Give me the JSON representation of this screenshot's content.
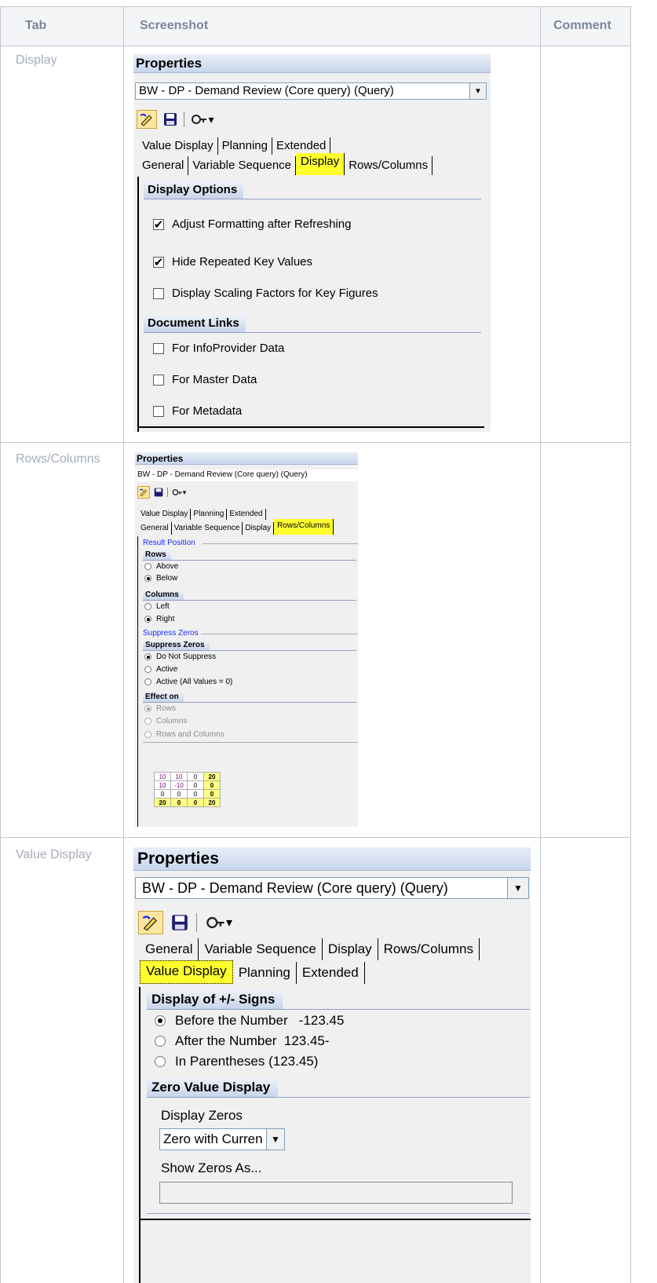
{
  "headers": {
    "tab": "Tab",
    "screenshot": "Screenshot",
    "comment": "Comment"
  },
  "rows": [
    {
      "tab": "Display"
    },
    {
      "tab": "Rows/Columns"
    },
    {
      "tab": "Value Display"
    }
  ],
  "panel_title": "Properties",
  "query_name": "BW - DP - Demand Review (Core query) (Query)",
  "tabs": {
    "value_display": "Value Display",
    "planning": "Planning",
    "extended": "Extended",
    "general": "General",
    "variable_sequence": "Variable Sequence",
    "display": "Display",
    "rows_columns": "Rows/Columns"
  },
  "display_panel": {
    "display_options": "Display Options",
    "adjust_formatting": "Adjust Formatting after Refreshing",
    "adjust_formatting_checked": true,
    "hide_repeated": "Hide Repeated Key Values",
    "hide_repeated_checked": true,
    "scaling_factors": "Display Scaling Factors for Key Figures",
    "scaling_factors_checked": false,
    "document_links": "Document Links",
    "infoprovider": "For InfoProvider Data",
    "master_data": "For Master Data",
    "metadata": "For Metadata"
  },
  "rows_panel": {
    "result_position": "Result Position",
    "rows": "Rows",
    "above": "Above",
    "below": "Below",
    "columns": "Columns",
    "left": "Left",
    "right": "Right",
    "suppress_zeros_section": "Suppress Zeros",
    "suppress_zeros": "Suppress Zeros",
    "do_not_suppress": "Do Not Suppress",
    "active": "Active",
    "active_all": "Active (All Values = 0)",
    "effect_on": "Effect on",
    "eff_rows": "Rows",
    "eff_columns": "Columns",
    "eff_rows_columns": "Rows and Columns",
    "example_table": [
      [
        "10",
        "10",
        "0",
        "20"
      ],
      [
        "10",
        "-10",
        "0",
        "0"
      ],
      [
        "0",
        "0",
        "0",
        "0"
      ],
      [
        "20",
        "0",
        "0",
        "20"
      ]
    ]
  },
  "value_panel": {
    "sign_header": "Display of +/- Signs",
    "before": "Before the Number   -123.45",
    "after": "After the Number  123.45-",
    "parentheses": "In Parentheses (123.45)",
    "zero_header": "Zero Value Display",
    "display_zeros": "Display Zeros",
    "zero_select": "Zero with Curren",
    "show_zeros_as": "Show Zeros As..."
  },
  "colors": {
    "highlight": "#ffff2e",
    "header_bg": "#f4f5f7",
    "border": "#c1c7d0"
  }
}
